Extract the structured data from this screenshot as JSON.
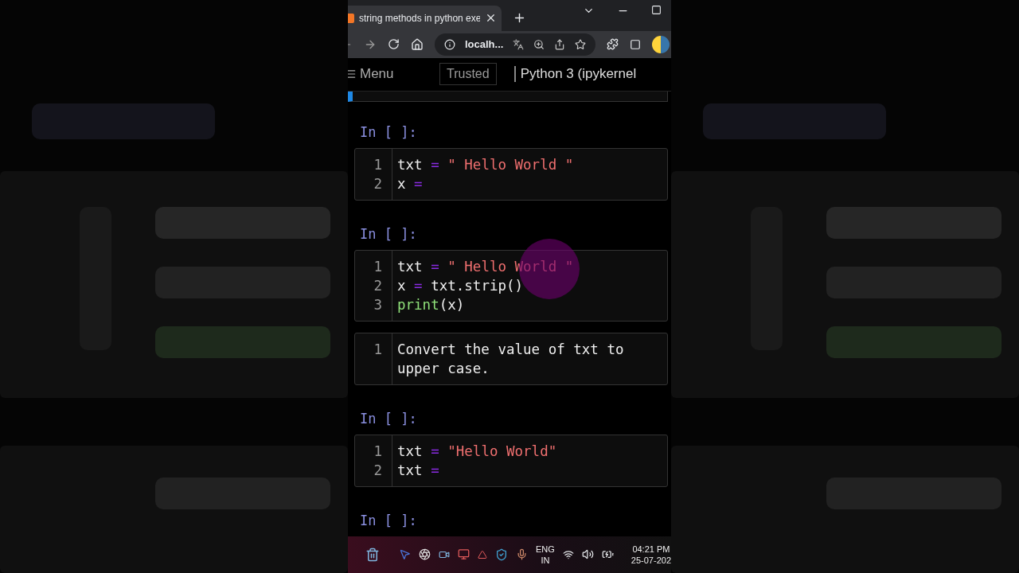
{
  "browser": {
    "tab_title": "string methods in python exe",
    "address": "localh..."
  },
  "toolbar": {
    "menu": "Menu",
    "trusted": "Trusted",
    "kernel": "Python 3 (ipykernel"
  },
  "cells": [
    {
      "kind": "code",
      "prompt": "In [ ]:",
      "lines": [
        {
          "number": "1",
          "tokens": [
            {
              "kind": "name",
              "text": "txt "
            },
            {
              "kind": "op",
              "text": "="
            },
            {
              "kind": "string",
              "text": " \" Hello World \""
            }
          ]
        },
        {
          "number": "2",
          "tokens": [
            {
              "kind": "name",
              "text": "x "
            },
            {
              "kind": "op",
              "text": "="
            }
          ]
        }
      ]
    },
    {
      "kind": "code",
      "prompt": "In [ ]:",
      "lines": [
        {
          "number": "1",
          "tokens": [
            {
              "kind": "name",
              "text": "txt "
            },
            {
              "kind": "op",
              "text": "="
            },
            {
              "kind": "string",
              "text": " \" Hello World \""
            }
          ]
        },
        {
          "number": "2",
          "tokens": [
            {
              "kind": "name",
              "text": "x "
            },
            {
              "kind": "op",
              "text": "="
            },
            {
              "kind": "name",
              "text": " txt.strip()"
            }
          ]
        },
        {
          "number": "3",
          "tokens": [
            {
              "kind": "builtin",
              "text": "print"
            },
            {
              "kind": "name",
              "text": "(x)"
            }
          ]
        }
      ]
    },
    {
      "kind": "markdown",
      "lines": [
        {
          "number": "1",
          "text": "Convert the value of txt to upper case."
        }
      ]
    },
    {
      "kind": "code",
      "prompt": "In [ ]:",
      "lines": [
        {
          "number": "1",
          "tokens": [
            {
              "kind": "name",
              "text": "txt "
            },
            {
              "kind": "op",
              "text": "="
            },
            {
              "kind": "string",
              "text": " \"Hello World\""
            }
          ]
        },
        {
          "number": "2",
          "tokens": [
            {
              "kind": "name",
              "text": "txt "
            },
            {
              "kind": "op",
              "text": "="
            }
          ]
        }
      ]
    },
    {
      "kind": "prompt",
      "prompt": "In [ ]:"
    }
  ],
  "taskbar": {
    "language": "ENG",
    "region": "IN",
    "time": "04:21 PM",
    "date": "25-07-202"
  }
}
